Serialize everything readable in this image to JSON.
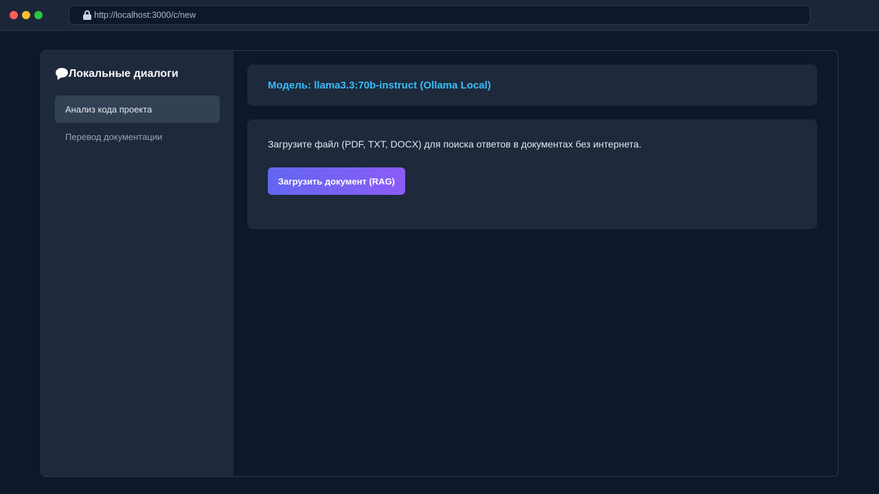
{
  "browser": {
    "url": "http://localhost:3000/c/new",
    "traffic_lights": [
      "#ff5f57",
      "#febc2e",
      "#28c840"
    ]
  },
  "sidebar": {
    "title": "Локальные диалоги",
    "title_icon": "speech-bubble-icon",
    "items": [
      {
        "label": "Анализ кода проекта",
        "active": true
      },
      {
        "label": "Перевод документации",
        "active": false
      }
    ]
  },
  "main": {
    "model_label": "Модель: llama3.3:70b-instruct (Ollama Local)",
    "upload": {
      "description": "Загрузите файл (PDF, TXT, DOCX) для поиска ответов в документах без интернета.",
      "button_label": "Загрузить документ (RAG)"
    }
  },
  "colors": {
    "background": "#0f172a",
    "panel": "#1e293b",
    "accent": "#38bdf8",
    "button_gradient": [
      "#6366f1",
      "#8b5cf6"
    ]
  }
}
